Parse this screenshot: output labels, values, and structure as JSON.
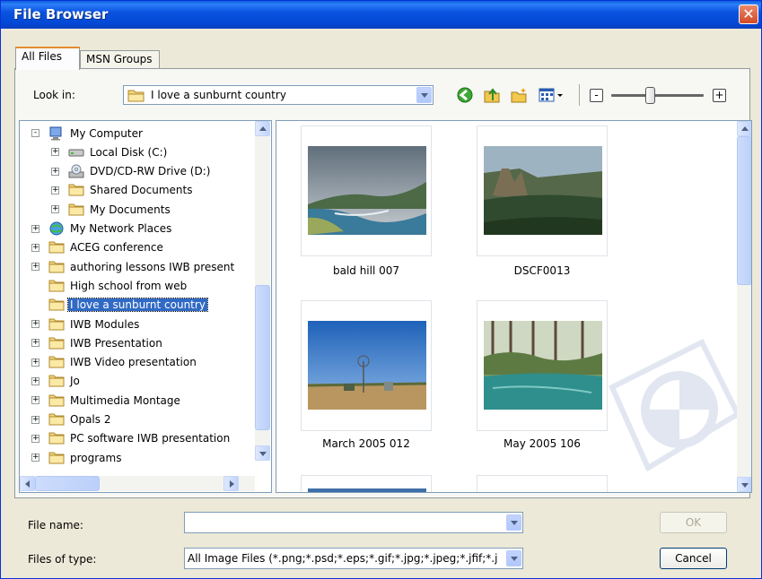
{
  "window": {
    "title": "File Browser",
    "close_icon": "close-icon"
  },
  "tabs": [
    {
      "label": "All Files",
      "active": true
    },
    {
      "label": "MSN Groups",
      "active": false
    }
  ],
  "look_in": {
    "label": "Look in:",
    "value": "I love a sunburnt country"
  },
  "toolbar": {
    "icons": [
      "back-icon",
      "up-folder-icon",
      "new-folder-icon",
      "view-menu-icon"
    ],
    "zoom_out": "-",
    "zoom_in": "+",
    "zoom_level": 0.42
  },
  "tree": {
    "items": [
      {
        "label": "My Computer",
        "depth": 0,
        "expander": "-",
        "icon": "computer-icon"
      },
      {
        "label": "Local Disk (C:)",
        "depth": 1,
        "expander": "+",
        "icon": "disk-icon"
      },
      {
        "label": "DVD/CD-RW Drive (D:)",
        "depth": 1,
        "expander": "+",
        "icon": "cd-drive-icon"
      },
      {
        "label": "Shared Documents",
        "depth": 1,
        "expander": "+",
        "icon": "folder-icon"
      },
      {
        "label": "My Documents",
        "depth": 1,
        "expander": "+",
        "icon": "folder-icon"
      },
      {
        "label": "My Network Places",
        "depth": 0,
        "expander": "+",
        "icon": "network-icon"
      },
      {
        "label": "ACEG conference",
        "depth": 0,
        "expander": "+",
        "icon": "folder-icon"
      },
      {
        "label": "authoring lessons IWB present",
        "depth": 0,
        "expander": "+",
        "icon": "folder-icon"
      },
      {
        "label": "High school from web",
        "depth": 0,
        "expander": "",
        "icon": "folder-icon"
      },
      {
        "label": "I love a sunburnt country",
        "depth": 0,
        "expander": "",
        "icon": "folder-icon",
        "selected": true
      },
      {
        "label": "IWB Modules",
        "depth": 0,
        "expander": "+",
        "icon": "folder-icon"
      },
      {
        "label": "IWB Presentation",
        "depth": 0,
        "expander": "+",
        "icon": "folder-icon"
      },
      {
        "label": "IWB Video presentation",
        "depth": 0,
        "expander": "+",
        "icon": "folder-icon"
      },
      {
        "label": "Jo",
        "depth": 0,
        "expander": "+",
        "icon": "folder-icon"
      },
      {
        "label": "Multimedia Montage",
        "depth": 0,
        "expander": "+",
        "icon": "folder-icon"
      },
      {
        "label": "Opals 2",
        "depth": 0,
        "expander": "+",
        "icon": "folder-icon"
      },
      {
        "label": "PC software IWB presentation",
        "depth": 0,
        "expander": "+",
        "icon": "folder-icon"
      },
      {
        "label": "programs",
        "depth": 0,
        "expander": "+",
        "icon": "folder-icon"
      }
    ]
  },
  "gallery": {
    "items": [
      {
        "label": "bald hill 007",
        "scene": "coastal-headland-photo"
      },
      {
        "label": "DSCF0013",
        "scene": "rock-formation-valley-photo"
      },
      {
        "label": "March 2005 012",
        "scene": "windmill-paddock-photo"
      },
      {
        "label": "May 2005 106",
        "scene": "waterhole-trees-photo"
      }
    ]
  },
  "file_name": {
    "label": "File name:",
    "value": ""
  },
  "file_type": {
    "label": "Files of type:",
    "value": "All Image Files (*.png;*.psd;*.eps;*.gif;*.jpg;*.jpeg;*.jfif;*.j"
  },
  "buttons": {
    "ok": "OK",
    "cancel": "Cancel"
  },
  "colors": {
    "title_bar": "#0a53e0",
    "selection": "#316ac5",
    "dialog_bg": "#ece9d8"
  }
}
